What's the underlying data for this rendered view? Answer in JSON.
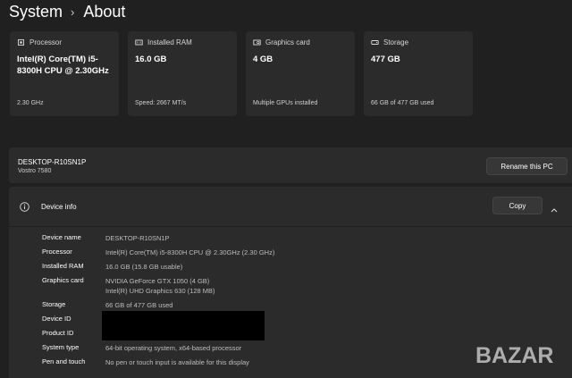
{
  "breadcrumb": {
    "parent": "System",
    "separator": "›",
    "current": "About"
  },
  "cards": [
    {
      "icon": "processor-icon",
      "label": "Processor",
      "value": "Intel(R) Core(TM) i5-8300H CPU @ 2.30GHz",
      "sub": "2.30 GHz"
    },
    {
      "icon": "ram-icon",
      "label": "Installed RAM",
      "value": "16.0 GB",
      "sub": "Speed: 2667 MT/s"
    },
    {
      "icon": "graphics-card-icon",
      "label": "Graphics card",
      "value": "4 GB",
      "sub": "Multiple GPUs installed"
    },
    {
      "icon": "storage-icon",
      "label": "Storage",
      "value": "477 GB",
      "sub": "66 GB of 477 GB used"
    }
  ],
  "pc": {
    "name": "DESKTOP-R10SN1P",
    "model": "Vostro 7580",
    "rename_label": "Rename this PC"
  },
  "device_info": {
    "title": "Device info",
    "copy_label": "Copy",
    "rows": [
      {
        "key": "Device name",
        "value": "DESKTOP-R10SN1P"
      },
      {
        "key": "Processor",
        "value": "Intel(R) Core(TM) i5-8300H CPU @ 2.30GHz (2.30 GHz)"
      },
      {
        "key": "Installed RAM",
        "value": "16.0 GB (15.8 GB usable)"
      },
      {
        "key": "Graphics card",
        "value": "NVIDIA GeForce GTX 1050 (4 GB)",
        "value2": "Intel(R) UHD Graphics 630 (128 MB)"
      },
      {
        "key": "Storage",
        "value": "66 GB of 477 GB used"
      },
      {
        "key": "Device ID",
        "value": ""
      },
      {
        "key": "Product ID",
        "value": ""
      },
      {
        "key": "System type",
        "value": "64-bit operating system, x64-based processor"
      },
      {
        "key": "Pen and touch",
        "value": "No pen or touch input is available for this display"
      }
    ]
  },
  "watermark": {
    "text": "BAZAR"
  }
}
